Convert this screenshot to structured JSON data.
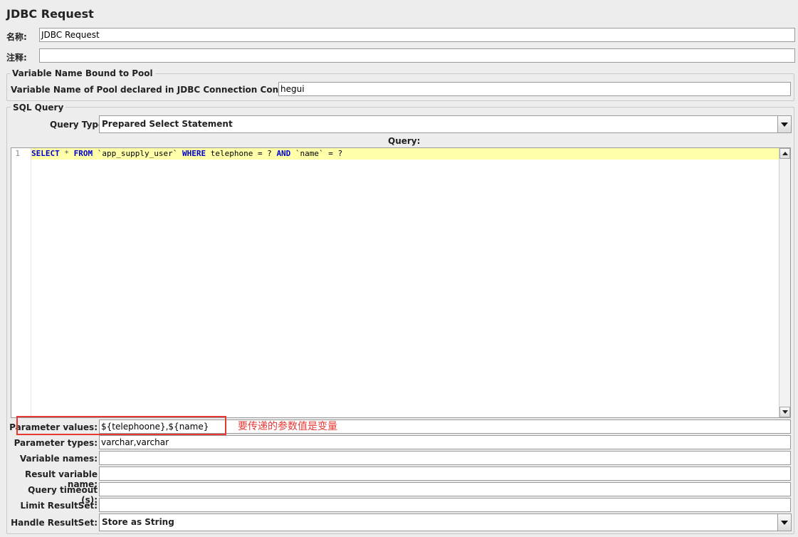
{
  "window": {
    "title": "JDBC Request"
  },
  "name_row": {
    "label": "名称:",
    "value": "JDBC Request"
  },
  "comment_row": {
    "label": "注释:",
    "value": ""
  },
  "pool_group": {
    "legend": "Variable Name Bound to Pool",
    "label": "Variable Name of Pool declared in JDBC Connection Configuration:",
    "value": "hegui"
  },
  "sql_group": {
    "legend": "SQL Query",
    "query_type_label": "Query Type:",
    "query_type_value": "Prepared Select Statement",
    "query_label": "Query:"
  },
  "editor": {
    "line_number": "1",
    "tokens": {
      "select": "SELECT",
      "star": " * ",
      "from": "FROM",
      "table": " `app_supply_user` ",
      "where": "WHERE",
      "cond1": " telephone = ? ",
      "and": "AND",
      "cond2": " `name` = ?"
    }
  },
  "params": {
    "values_label": "Parameter values:",
    "values_value": "${telephoone},${name}",
    "types_label": "Parameter types:",
    "types_value": "varchar,varchar",
    "varnames_label": "Variable names:",
    "varnames_value": "",
    "resultvar_label": "Result variable name:",
    "resultvar_value": "",
    "timeout_label": "Query timeout (s):",
    "timeout_value": "",
    "limit_label": "Limit ResultSet:",
    "limit_value": "",
    "handle_label": "Handle ResultSet:",
    "handle_value": "Store as String"
  },
  "annotation": {
    "text": "要传递的参数值是变量",
    "color": "#e53935"
  },
  "colors": {
    "keyword": "#0000cc",
    "line_highlight": "#ffffaa",
    "background": "#ededed"
  }
}
